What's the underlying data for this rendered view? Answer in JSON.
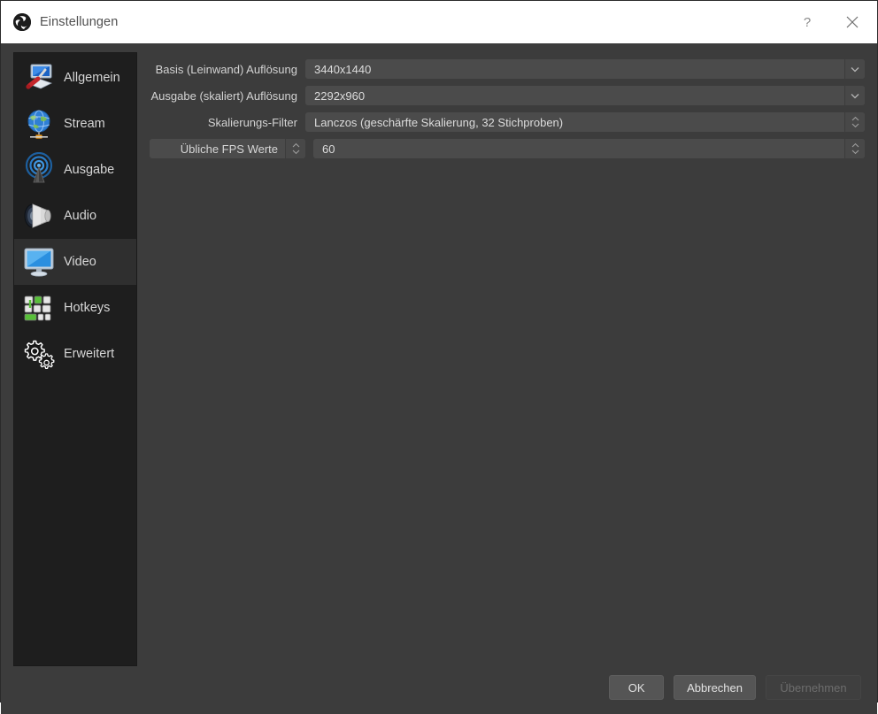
{
  "window": {
    "title": "Einstellungen",
    "logo_icon": "obs-logo-icon",
    "help_label": "?",
    "close_icon": "close-icon"
  },
  "sidebar": {
    "items": [
      {
        "label": "Allgemein",
        "icon": "general-monitor-screwdriver-icon",
        "selected": false
      },
      {
        "label": "Stream",
        "icon": "globe-stream-icon",
        "selected": false
      },
      {
        "label": "Ausgabe",
        "icon": "broadcast-antenna-icon",
        "selected": false
      },
      {
        "label": "Audio",
        "icon": "speaker-icon",
        "selected": false
      },
      {
        "label": "Video",
        "icon": "monitor-icon",
        "selected": true
      },
      {
        "label": "Hotkeys",
        "icon": "keyboard-icon",
        "selected": false
      },
      {
        "label": "Erweitert",
        "icon": "gears-icon",
        "selected": false
      }
    ]
  },
  "video_settings": {
    "base_resolution": {
      "label": "Basis (Leinwand) Auflösung",
      "value": "3440x1440",
      "control": "combobox"
    },
    "output_resolution": {
      "label": "Ausgabe (skaliert) Auflösung",
      "value": "2292x960",
      "control": "combobox"
    },
    "scale_filter": {
      "label": "Skalierungs-Filter",
      "value": "Lanczos (geschärfte Skalierung, 32 Stichproben)",
      "control": "spinbox"
    },
    "fps": {
      "label": "Übliche FPS Werte",
      "value": "60",
      "control": "spinbox"
    }
  },
  "footer": {
    "ok_label": "OK",
    "cancel_label": "Abbrechen",
    "apply_label": "Übernehmen",
    "apply_disabled": true
  },
  "colors": {
    "titlebar_bg": "#ffffff",
    "dialog_bg": "#3c3c3c",
    "sidebar_bg": "#1e1e1e",
    "sidebar_selected_bg": "#2f2f2f",
    "field_bg": "#4b4b4b",
    "text": "#d6d6d6",
    "accent_blue": "#3a80c8"
  }
}
